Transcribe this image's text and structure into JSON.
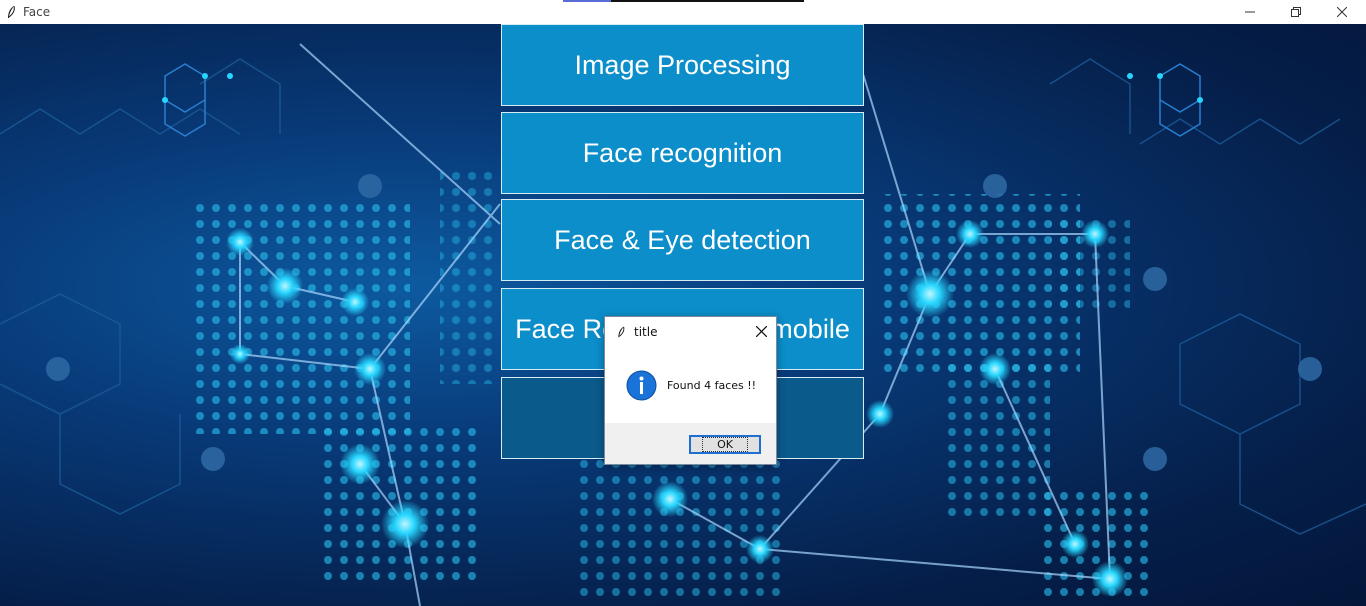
{
  "window": {
    "title": "Face",
    "icon": "feather-icon",
    "controls": [
      "minimize-icon",
      "restore-icon",
      "close-icon"
    ]
  },
  "menu": {
    "buttons": [
      {
        "label": "Image Processing"
      },
      {
        "label": "Face recognition"
      },
      {
        "label": "Face & Eye detection"
      },
      {
        "label": "Face Recognition on mobile",
        "visible_parts": [
          "Face Re",
          "mobile"
        ]
      },
      {
        "label": ""
      }
    ]
  },
  "dialog": {
    "title": "title",
    "icon": "info-icon",
    "message": "Found 4 faces !!",
    "ok_label": "OK"
  },
  "colors": {
    "button_bg": "#0b8ec9",
    "button_dark_bg": "#0b5a8c",
    "background_dark": "#051f4a",
    "accent_cyan": "#27d6ff"
  }
}
